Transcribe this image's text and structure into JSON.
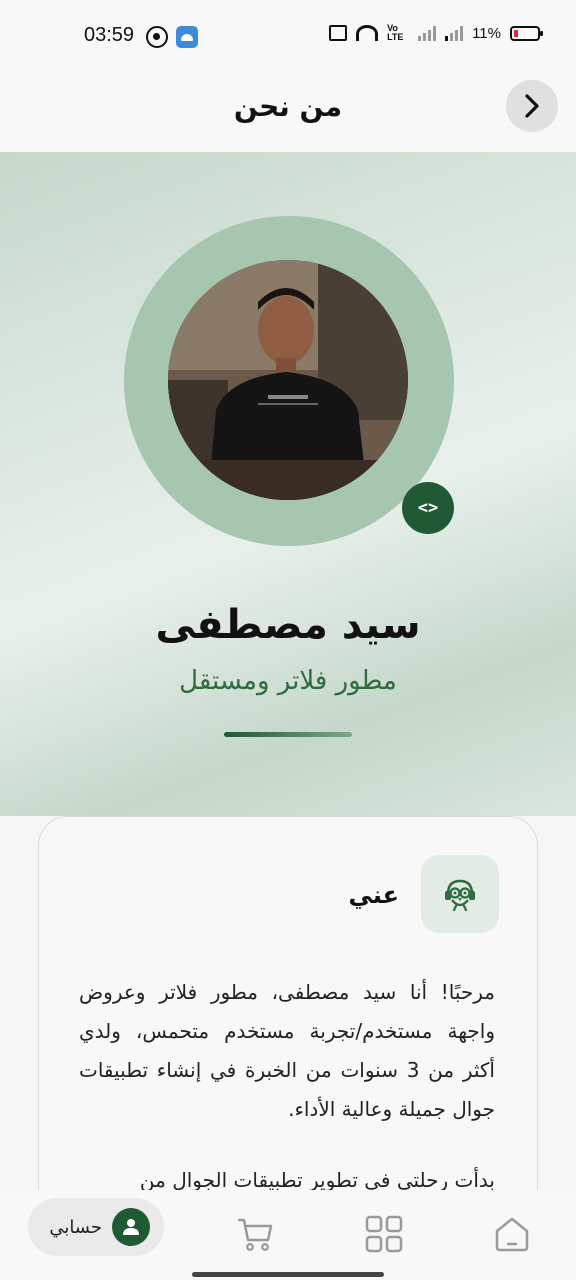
{
  "status_bar": {
    "time": "03:59",
    "network_label": "Vo LTE",
    "battery_percent": "11%",
    "left_icons": [
      "whatsapp-icon",
      "android-icon"
    ],
    "right_icons": [
      "screen-cast-icon",
      "wifi-icon",
      "volte-icon",
      "signal-icon",
      "signal-icon",
      "battery-icon"
    ]
  },
  "app_bar": {
    "title": "من نحن",
    "back_icon": "chevron-right-icon"
  },
  "profile": {
    "name": "سيد مصطفى",
    "role": "مطور فلاتر ومستقل",
    "badge_icon": "code-icon",
    "badge_text": "<>"
  },
  "about": {
    "title": "عني",
    "icon": "owl-icon",
    "paragraphs": [
      "مرحبًا! أنا سيد مصطفى، مطور فلاتر وعروض واجهة مستخدم/تجربة مستخدم متحمس، ولدي أكثر من 3 سنوات من الخبرة في إنشاء تطبيقات جوال جميلة وعالية الأداء.",
      "بدأت رحلتي في تطوير تطبيقات الجوال من"
    ]
  },
  "bottom_nav": {
    "account_label": "حسابي",
    "items": [
      "account-icon",
      "cart-icon",
      "categories-icon",
      "home-icon"
    ]
  },
  "colors": {
    "brand_green": "#1f5a34",
    "role_green": "#2e6b3f",
    "hero_bg": "#c6d8cc"
  }
}
